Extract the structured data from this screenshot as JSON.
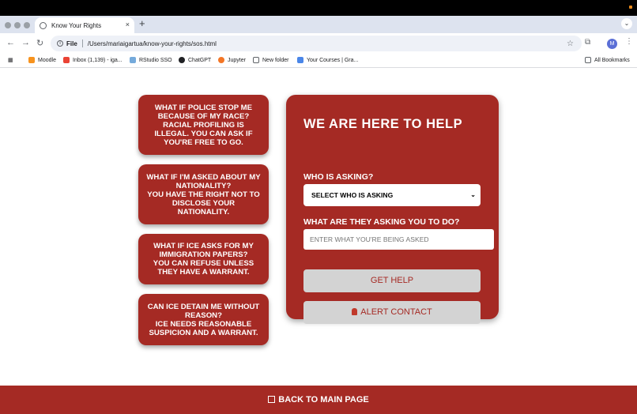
{
  "browser": {
    "tab_title": "Know Your Rights",
    "new_tab": "+",
    "tab_close": "×",
    "address_scheme": "File",
    "address_path": "/Users/mariaigartua/know-your-rights/sos.html",
    "profile_initial": "M",
    "bookmarks": [
      "Moodle",
      "Inbox (1,139) - iga...",
      "RStudio SSO",
      "ChatGPT",
      "Jupyter",
      "New folder",
      "Your Courses | Gra..."
    ],
    "all_bookmarks": "All Bookmarks"
  },
  "cards": [
    {
      "question": "What if police stop me because of my race?",
      "answer": "Racial profiling is illegal. You can ask if you're free to go."
    },
    {
      "question": "What if I'm asked about my nationality?",
      "answer": "You have the right not to disclose your nationality."
    },
    {
      "question": "What if ICE asks for my immigration papers?",
      "answer": "You can refuse unless they have a warrant."
    },
    {
      "question": "Can ICE detain me without reason?",
      "answer": "ICE needs reasonable suspicion and a warrant."
    }
  ],
  "help_panel": {
    "title": "WE ARE HERE TO HELP",
    "who_label": "WHO IS ASKING?",
    "who_select": "SELECT WHO IS ASKING",
    "what_label": "WHAT ARE THEY ASKING YOU TO DO?",
    "what_placeholder": "ENTER WHAT YOU'RE BEING ASKED",
    "get_help": "GET HELP",
    "alert_contact": "ALERT CONTACT"
  },
  "footer": {
    "back_label": "BACK TO MAIN PAGE"
  },
  "colors": {
    "brand": "#a52a24",
    "button_bg": "#d3d3d3"
  }
}
